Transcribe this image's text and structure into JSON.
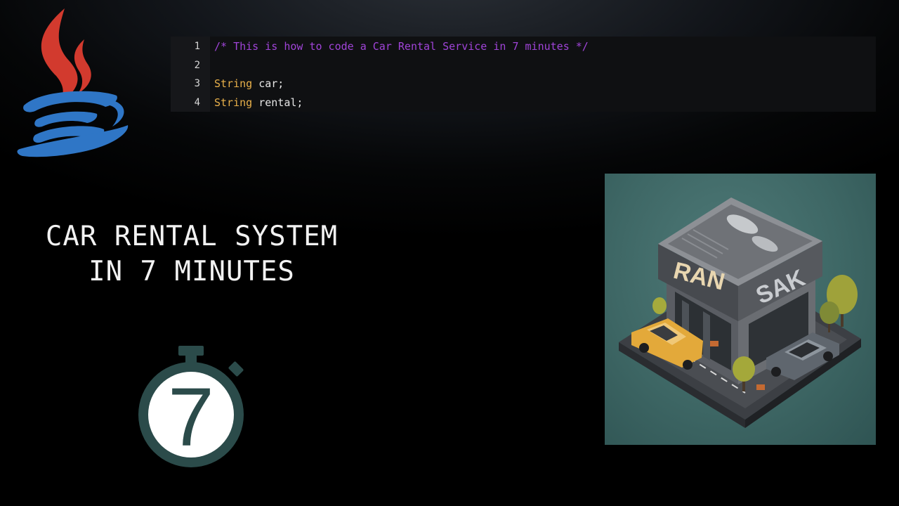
{
  "code_editor": {
    "lines": [
      {
        "number": "1",
        "tokens": [
          {
            "text": "/* This is how to code a Car Rental Service in 7 minutes */",
            "kind": "comment"
          }
        ]
      },
      {
        "number": "2",
        "tokens": []
      },
      {
        "number": "3",
        "tokens": [
          {
            "text": "String",
            "kind": "type"
          },
          {
            "text": " car;",
            "kind": "plain"
          }
        ]
      },
      {
        "number": "4",
        "tokens": [
          {
            "text": "String",
            "kind": "type"
          },
          {
            "text": " rental;",
            "kind": "plain"
          }
        ]
      }
    ]
  },
  "title": {
    "line1": "CAR RENTAL SYSTEM",
    "line2": "IN 7 MINUTES"
  },
  "stopwatch": {
    "number": "7"
  },
  "illustration": {
    "sign_left": "RAN",
    "sign_right": "SAK"
  },
  "colors": {
    "comment": "#a044d8",
    "type": "#e8b04a",
    "stopwatch": "#2b4b4a",
    "java_red": "#d23a2e",
    "java_blue": "#2f76c6"
  },
  "icons": {
    "logo": "java-logo-icon",
    "timer": "stopwatch-icon"
  }
}
